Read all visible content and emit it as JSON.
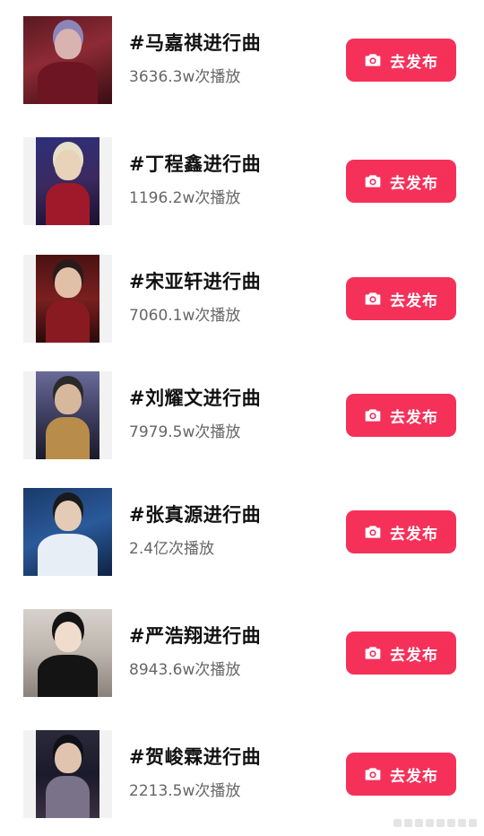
{
  "items": [
    {
      "title": "#马嘉祺进行曲",
      "plays": "3636.3w次播放",
      "button": "去发布"
    },
    {
      "title": "#丁程鑫进行曲",
      "plays": "1196.2w次播放",
      "button": "去发布"
    },
    {
      "title": "#宋亚轩进行曲",
      "plays": "7060.1w次播放",
      "button": "去发布"
    },
    {
      "title": "#刘耀文进行曲",
      "plays": "7979.5w次播放",
      "button": "去发布"
    },
    {
      "title": "#张真源进行曲",
      "plays": "2.4亿次播放",
      "button": "去发布"
    },
    {
      "title": "#严浩翔进行曲",
      "plays": "8943.6w次播放",
      "button": "去发布"
    },
    {
      "title": "#贺峻霖进行曲",
      "plays": "2213.5w次播放",
      "button": "去发布"
    }
  ],
  "button_icon": "camera-icon",
  "colors": {
    "button_bg": "#f5315a",
    "button_text": "#ffffff",
    "title_text": "#111111",
    "plays_text": "#666666"
  }
}
